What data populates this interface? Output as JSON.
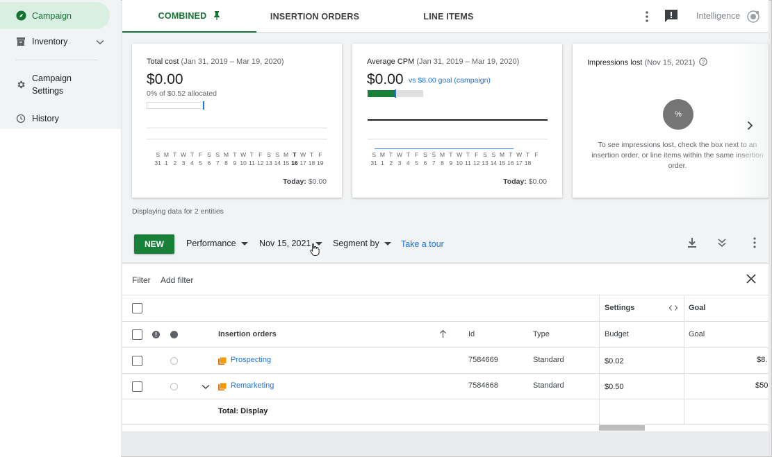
{
  "sidebar": {
    "items": [
      {
        "label": "Campaign"
      },
      {
        "label": "Inventory"
      },
      {
        "label": "Campaign\nSettings",
        "line1": "Campaign",
        "line2": "Settings"
      },
      {
        "label": "History"
      }
    ]
  },
  "tabs": [
    {
      "label": "COMBINED"
    },
    {
      "label": "INSERTION ORDERS"
    },
    {
      "label": "LINE ITEMS"
    }
  ],
  "topbar": {
    "intelligence_label": "Intelligence"
  },
  "cards": {
    "total_cost": {
      "title": "Total cost",
      "range": "(Jan 31, 2019 – Mar 19, 2020)",
      "value": "$0.00",
      "allocated": "0% of $0.52 allocated",
      "today_label": "Today:",
      "today_value": "$0.00"
    },
    "avg_cpm": {
      "title": "Average CPM",
      "range": "(Jan 31, 2019 – Mar 19, 2020)",
      "value": "$0.00",
      "goal": "vs $8.00 goal (campaign)",
      "progress_fraction": 0.5,
      "today_label": "Today:",
      "today_value": "$0.00"
    },
    "impressions_lost": {
      "title": "Impressions lost",
      "range": "(Nov 15, 2021)",
      "circle_label": "%",
      "message": "To see impressions lost, check the box next to an insertion order, or line items within the same insertion order."
    },
    "days_letters": [
      "S",
      "M",
      "T",
      "W",
      "T",
      "F",
      "S",
      "S",
      "M",
      "T",
      "W",
      "T",
      "F",
      "S",
      "S",
      "M",
      "T",
      "W",
      "T",
      "F"
    ],
    "days_numbers": [
      "31",
      "1",
      "2",
      "3",
      "4",
      "5",
      "6",
      "7",
      "8",
      "9",
      "10",
      "11",
      "12",
      "13",
      "14",
      "15",
      "16",
      "17",
      "18",
      "19"
    ],
    "days_letters_cpm": [
      "S",
      "M",
      "T",
      "W",
      "T",
      "F",
      "S",
      "S",
      "M",
      "T",
      "W",
      "T",
      "F",
      "S",
      "S",
      "M",
      "T",
      "W",
      "T",
      "F"
    ],
    "days_numbers_cpm": [
      "31",
      "1",
      "2",
      "3",
      "4",
      "5",
      "6",
      "7",
      "8",
      "9",
      "10",
      "11",
      "12",
      "13",
      "14",
      "15",
      "16",
      "17",
      "18"
    ]
  },
  "entities_text": "Displaying data for 2 entities",
  "toolbar": {
    "new_label": "NEW",
    "performance_label": "Performance",
    "date_label": "Nov 15, 2021",
    "segment_label": "Segment by",
    "tour_label": "Take a tour"
  },
  "filter": {
    "label": "Filter",
    "add_label": "Add filter"
  },
  "table": {
    "group_headers": {
      "settings": "Settings",
      "goal": "Goal"
    },
    "columns": {
      "name": "Insertion orders",
      "id": "Id",
      "type": "Type",
      "budget": "Budget",
      "goal": "Goal"
    },
    "rows": [
      {
        "name": "Prospecting",
        "id": "7584669",
        "type": "Standard",
        "budget": "$0.02",
        "goal": "$8."
      },
      {
        "name": "Remarketing",
        "id": "7584668",
        "type": "Standard",
        "budget": "$0.50",
        "goal": "$50"
      }
    ],
    "total_label": "Total: Display"
  },
  "colors": {
    "accent_green": "#188038",
    "link_blue": "#1a73e8",
    "selected_nav_bg": "#d9efe2"
  }
}
